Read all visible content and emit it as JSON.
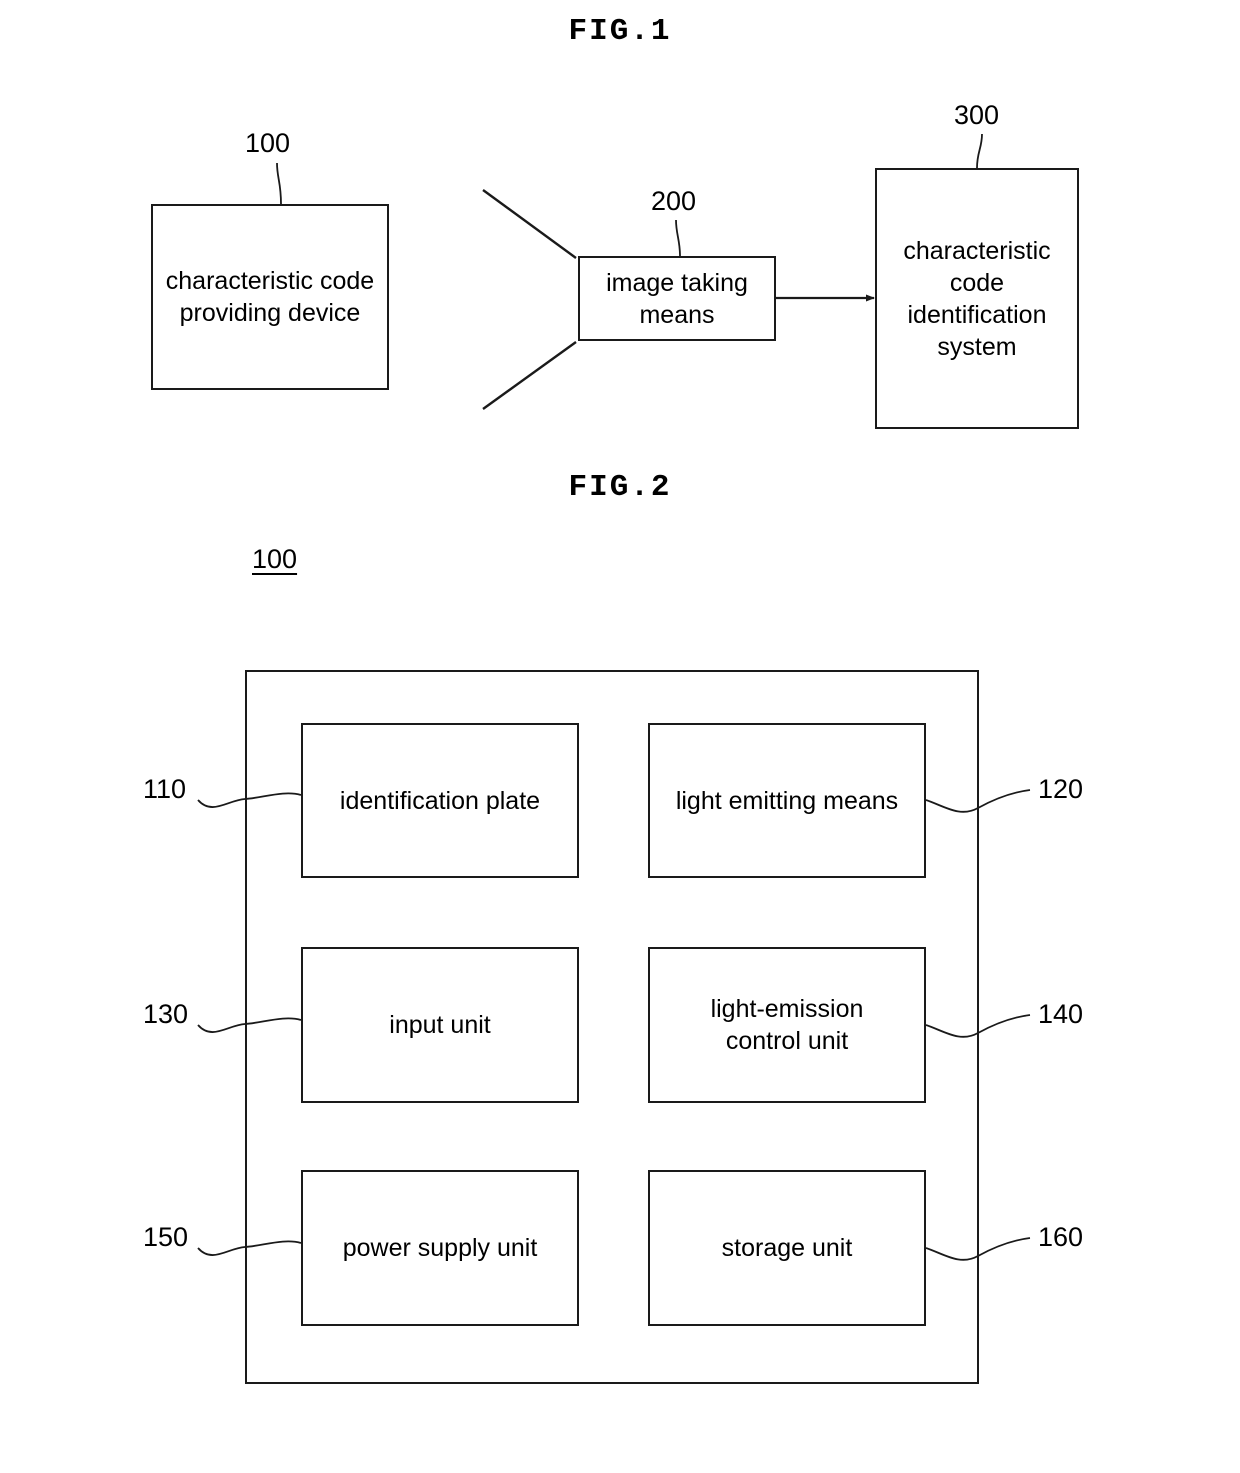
{
  "document": {
    "type": "patent-drawing-sheet"
  },
  "figures": [
    {
      "title": "FIG.1",
      "nodes": [
        {
          "ref": "100",
          "label": "characteristic code\nproviding device"
        },
        {
          "ref": "200",
          "label": "image taking\nmeans"
        },
        {
          "ref": "300",
          "label": "characteristic\ncode\nidentification\nsystem"
        }
      ],
      "connectors": [
        {
          "from": "200",
          "to": "300",
          "style": "solid-arrow"
        },
        {
          "from": "100",
          "to": "200",
          "style": "field-of-view-cone"
        }
      ]
    },
    {
      "title": "FIG.2",
      "container_ref": "100",
      "nodes": [
        {
          "ref": "110",
          "label": "identification plate",
          "side": "left",
          "row": 1
        },
        {
          "ref": "120",
          "label": "light emitting means",
          "side": "right",
          "row": 1
        },
        {
          "ref": "130",
          "label": "input unit",
          "side": "left",
          "row": 2
        },
        {
          "ref": "140",
          "label": "light-emission\ncontrol unit",
          "side": "right",
          "row": 2
        },
        {
          "ref": "150",
          "label": "power supply unit",
          "side": "left",
          "row": 3
        },
        {
          "ref": "160",
          "label": "storage unit",
          "side": "right",
          "row": 3
        }
      ]
    }
  ],
  "fig1": {
    "title": "FIG.1",
    "box_100": {
      "ref": "100",
      "label": "characteristic code\nproviding device"
    },
    "box_200": {
      "ref": "200",
      "label": "image taking\nmeans"
    },
    "box_300": {
      "ref": "300",
      "label": "characteristic\ncode\nidentification\nsystem"
    }
  },
  "fig2": {
    "title": "FIG.2",
    "container_ref": "100",
    "box_110": {
      "ref": "110",
      "label": "identification plate"
    },
    "box_120": {
      "ref": "120",
      "label": "light emitting means"
    },
    "box_130": {
      "ref": "130",
      "label": "input unit"
    },
    "box_140": {
      "ref": "140",
      "label": "light-emission\ncontrol unit"
    },
    "box_150": {
      "ref": "150",
      "label": "power supply unit"
    },
    "box_160": {
      "ref": "160",
      "label": "storage unit"
    }
  },
  "colors": {
    "ink": "#1a1a1a",
    "paper": "#ffffff"
  }
}
